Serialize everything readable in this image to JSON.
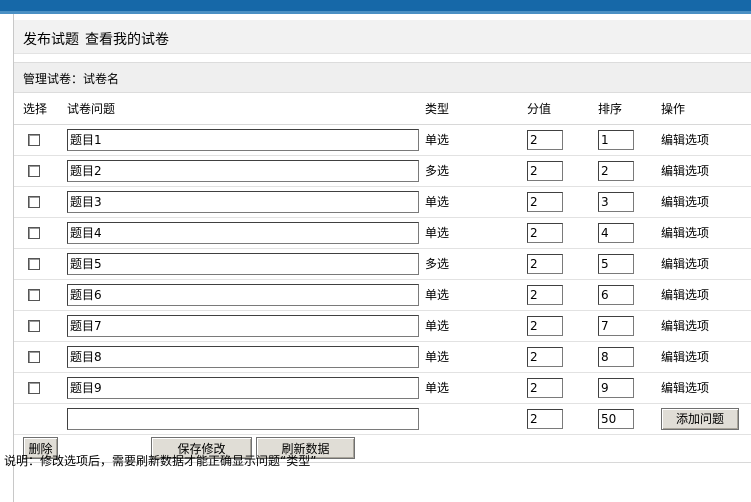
{
  "nav": {
    "publish_label": "发布试题",
    "view_label": "查看我的试卷"
  },
  "manage": {
    "label": "管理试卷：试卷名"
  },
  "table": {
    "headers": {
      "select": "选择",
      "question": "试卷问题",
      "type": "类型",
      "score": "分值",
      "order": "排序",
      "action": "操作"
    },
    "rows": [
      {
        "question": "题目1",
        "type": "单选",
        "score": "2",
        "order": "1",
        "action": "编辑选项"
      },
      {
        "question": "题目2",
        "type": "多选",
        "score": "2",
        "order": "2",
        "action": "编辑选项"
      },
      {
        "question": "题目3",
        "type": "单选",
        "score": "2",
        "order": "3",
        "action": "编辑选项"
      },
      {
        "question": "题目4",
        "type": "单选",
        "score": "2",
        "order": "4",
        "action": "编辑选项"
      },
      {
        "question": "题目5",
        "type": "多选",
        "score": "2",
        "order": "5",
        "action": "编辑选项"
      },
      {
        "question": "题目6",
        "type": "单选",
        "score": "2",
        "order": "6",
        "action": "编辑选项"
      },
      {
        "question": "题目7",
        "type": "单选",
        "score": "2",
        "order": "7",
        "action": "编辑选项"
      },
      {
        "question": "题目8",
        "type": "单选",
        "score": "2",
        "order": "8",
        "action": "编辑选项"
      },
      {
        "question": "题目9",
        "type": "单选",
        "score": "2",
        "order": "9",
        "action": "编辑选项"
      }
    ],
    "new_row": {
      "question": "",
      "score": "2",
      "order": "50",
      "add_label": "添加问题"
    }
  },
  "actions": {
    "delete_label": "删除",
    "save_label": "保存修改",
    "refresh_label": "刷新数据"
  },
  "note": "说明：修改选项后，需要刷新数据才能正确显示问题“类型”",
  "colors": {
    "top_band": "#1668a8",
    "nav_bg": "#f2f2f2",
    "button_bg": "#e0ddd6"
  }
}
